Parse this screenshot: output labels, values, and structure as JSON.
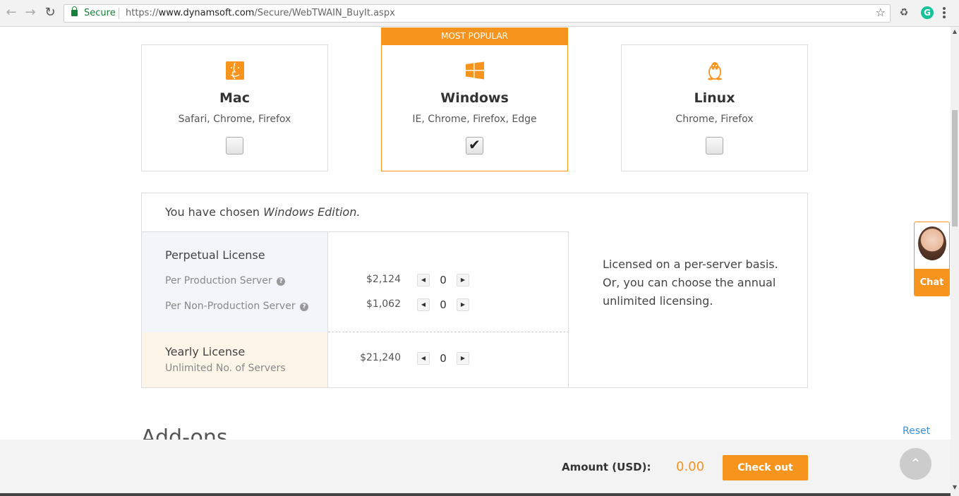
{
  "browser": {
    "secure_label": "Secure",
    "url_scheme": "https://",
    "url_domain": "www.dynamsoft.com",
    "url_path": "/Secure/WebTWAIN_BuyIt.aspx"
  },
  "platforms": {
    "popular_badge": "MOST POPULAR",
    "items": [
      {
        "name": "Mac",
        "browsers": "Safari, Chrome, Firefox",
        "checked": false,
        "icon": "mac-finder-icon"
      },
      {
        "name": "Windows",
        "browsers": "IE, Chrome, Firefox, Edge",
        "checked": true,
        "icon": "windows-logo-icon"
      },
      {
        "name": "Linux",
        "browsers": "Chrome, Firefox",
        "checked": false,
        "icon": "linux-tux-icon"
      }
    ]
  },
  "license": {
    "chosen_prefix": "You have chosen ",
    "chosen_edition": "Windows Edition.",
    "perpetual": {
      "title": "Perpetual License",
      "rows": [
        {
          "label": "Per Production Server",
          "price": "$2,124",
          "qty": "0"
        },
        {
          "label": "Per Non-Production Server",
          "price": "$1,062",
          "qty": "0"
        }
      ]
    },
    "yearly": {
      "title": "Yearly License",
      "subtitle": "Unlimited No. of Servers",
      "price": "$21,240",
      "qty": "0"
    },
    "description": "Licensed on a per-server basis. Or, you can choose the annual unlimited licensing."
  },
  "chat": {
    "label": "Chat"
  },
  "addons": {
    "heading": "Add-ons",
    "reset": "Reset"
  },
  "footer": {
    "amount_label": "Amount (USD):",
    "amount_value": "0.00",
    "checkout": "Check out"
  },
  "colors": {
    "accent": "#f7941d",
    "link": "#3b8fd9"
  }
}
